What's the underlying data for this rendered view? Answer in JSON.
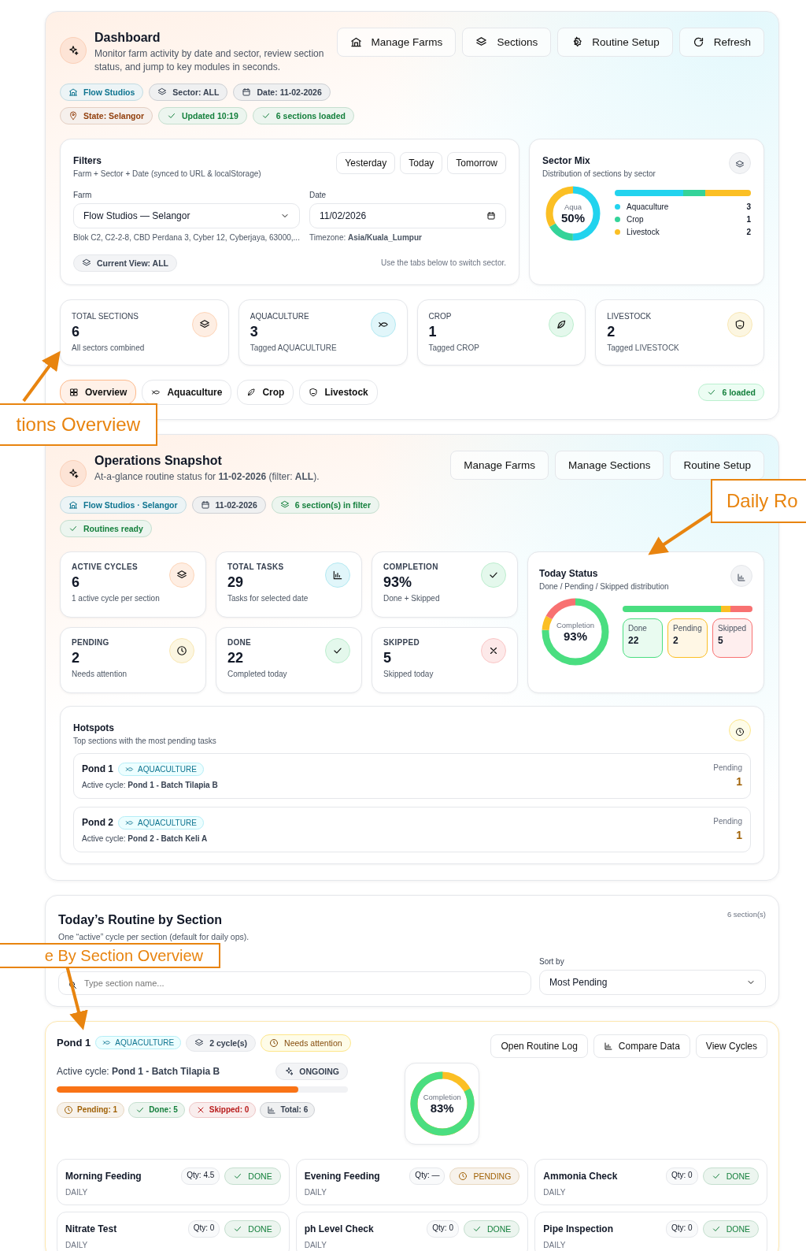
{
  "dashboard": {
    "title": "Dashboard",
    "subtitle": "Monitor farm activity by date and sector, review section status, and jump to key modules in seconds.",
    "actions": [
      {
        "label": "Manage Farms",
        "kind": "farm"
      },
      {
        "label": "Sections",
        "kind": "layers"
      },
      {
        "label": "Routine Setup",
        "kind": "gear"
      },
      {
        "label": "Refresh",
        "kind": "refresh"
      }
    ],
    "chip_rows": [
      [
        {
          "label": "Flow Studios",
          "kind": "farm",
          "color": "#0e7490"
        },
        {
          "label": "Sector: ALL",
          "kind": "layers",
          "color": "#374151"
        },
        {
          "label": "Date: 11-02-2026",
          "kind": "calendar",
          "color": "#374151"
        }
      ],
      [
        {
          "label": "State: Selangor",
          "kind": "pin",
          "color": "#92400e"
        },
        {
          "label": "Updated 10:19",
          "kind": "check",
          "color": "#15803d"
        },
        {
          "label": "6 sections loaded",
          "kind": "check",
          "color": "#15803d"
        }
      ]
    ],
    "filters": {
      "title": "Filters",
      "subtitle": "Farm + Sector + Date (synced to URL & localStorage)",
      "quick": [
        "Yesterday",
        "Today",
        "Tomorrow"
      ],
      "farm_label": "Farm",
      "farm_value": "Flow Studios — Selangor",
      "address": "Blok C2, C2-2-8, CBD Perdana 3, Cyber 12, Cyberjaya, 63000,...",
      "date_label": "Date",
      "date_value": "11/02/2026",
      "timezone": "Timezone: **Asia/Kuala_Lumpur**",
      "current_view": "Current View: ALL",
      "hint": "Use the tabs below to switch sector."
    },
    "sector_mix": {
      "title": "Sector Mix",
      "subtitle": "Distribution of sections by sector",
      "center_label": "Aqua",
      "center_value": "50%",
      "sectors": [
        {
          "name": "Aquaculture",
          "count": "3",
          "color": "#22d3ee"
        },
        {
          "name": "Crop",
          "count": "1",
          "color": "#34d399"
        },
        {
          "name": "Livestock",
          "count": "2",
          "color": "#fbbf24"
        }
      ]
    },
    "stats": [
      {
        "label": "TOTAL SECTIONS",
        "value": "6",
        "note": "All sectors combined",
        "kind": "layers"
      },
      {
        "label": "AQUACULTURE",
        "value": "3",
        "note": "Tagged AQUACULTURE",
        "kind": "fish"
      },
      {
        "label": "CROP",
        "value": "1",
        "note": "Tagged CROP",
        "kind": "leaf"
      },
      {
        "label": "LIVESTOCK",
        "value": "2",
        "note": "Tagged LIVESTOCK",
        "kind": "shield"
      }
    ],
    "tabs": [
      {
        "label": "Overview",
        "kind": "grid",
        "selected": true
      },
      {
        "label": "Aquaculture",
        "kind": "fish",
        "selected": false
      },
      {
        "label": "Crop",
        "kind": "leaf",
        "selected": false
      },
      {
        "label": "Livestock",
        "kind": "shield",
        "selected": false
      }
    ],
    "loaded_badge": "6 loaded"
  },
  "snapshot": {
    "title": "Operations Snapshot",
    "subtitle": "At-a-glance routine status for **11-02-2026** (filter: **ALL**).",
    "actions": [
      "Manage Farms",
      "Manage Sections",
      "Routine Setup"
    ],
    "chip_rows": [
      [
        {
          "label": "**Flow Studios** · Selangor",
          "kind": "farm",
          "color": "#0e7490"
        },
        {
          "label": "11-02-2026",
          "kind": "calendar",
          "color": "#374151"
        },
        {
          "label": "6 section(s) in filter",
          "kind": "layers",
          "color": "#15803d"
        }
      ],
      [
        {
          "label": "Routines ready",
          "kind": "check",
          "color": "#15803d"
        }
      ]
    ],
    "metrics": [
      {
        "label": "ACTIVE CYCLES",
        "value": "6",
        "note": "1 active cycle per section",
        "kind": "layers"
      },
      {
        "label": "TOTAL TASKS",
        "value": "29",
        "note": "Tasks for selected date",
        "kind": "chart"
      },
      {
        "label": "COMPLETION",
        "value": "93%",
        "note": "Done + Skipped",
        "kind": "check"
      },
      {
        "label": "PENDING",
        "value": "2",
        "note": "Needs attention",
        "kind": "clock"
      },
      {
        "label": "DONE",
        "value": "22",
        "note": "Completed today",
        "kind": "check"
      },
      {
        "label": "SKIPPED",
        "value": "5",
        "note": "Skipped today",
        "kind": "x"
      }
    ],
    "today_status": {
      "title": "Today Status",
      "subtitle": "Done / Pending / Skipped distribution",
      "center_label": "Completion",
      "center_value": "93%",
      "parts": [
        {
          "label": "Done",
          "value": "22",
          "color": "#4ade80"
        },
        {
          "label": "Pending",
          "value": "2",
          "color": "#fbbf24"
        },
        {
          "label": "Skipped",
          "value": "5",
          "color": "#f87171"
        }
      ]
    },
    "hotspots": {
      "title": "Hotspots",
      "subtitle": "Top sections with the most pending tasks",
      "items": [
        {
          "name": "Pond 1",
          "tag": "AQUACULTURE",
          "cycle": "Active cycle: **Pond 1 - Batch Tilapia B**",
          "pending_label": "Pending",
          "pending": "1"
        },
        {
          "name": "Pond 2",
          "tag": "AQUACULTURE",
          "cycle": "Active cycle: **Pond 2 - Batch Keli A**",
          "pending_label": "Pending",
          "pending": "1"
        }
      ]
    }
  },
  "routine": {
    "title": "Today’s Routine by Section",
    "subtitle": "One “active” cycle per section (default for daily ops).",
    "count": "6 section(s)",
    "search_placeholder": "Type section name...",
    "sort_label": "Sort by",
    "sort_value": "Most Pending"
  },
  "section_card": {
    "name": "Pond 1",
    "tag": "AQUACULTURE",
    "cycles": "2 cycle(s)",
    "attention": "Needs attention",
    "actions": [
      {
        "label": "Open Routine Log",
        "kind": "plain"
      },
      {
        "label": "Compare Data",
        "kind": "chart"
      },
      {
        "label": "View Cycles",
        "kind": "plain"
      }
    ],
    "cycle": "Active cycle: **Pond 1 - Batch Tilapia B**",
    "status": "ONGOING",
    "progress": {
      "level": 0.83
    },
    "counts": [
      {
        "label": "Pending: **1**",
        "kind": "clock",
        "color": "#a16207"
      },
      {
        "label": "Done: **5**",
        "kind": "check",
        "color": "#15803d"
      },
      {
        "label": "Skipped: **0**",
        "kind": "x",
        "color": "#b91c1c"
      },
      {
        "label": "Total: **6**",
        "kind": "chart",
        "color": "#374151"
      }
    ],
    "completion": {
      "label": "Completion",
      "value": "83%",
      "level": 0.83
    },
    "tasks": [
      {
        "name": "Morning Feeding",
        "qty": "Qty: 4.5",
        "status": "DONE",
        "kind": "done",
        "freq": "DAILY"
      },
      {
        "name": "Evening Feeding",
        "qty": "Qty: —",
        "status": "PENDING",
        "kind": "pending",
        "freq": "DAILY"
      },
      {
        "name": "Ammonia Check",
        "qty": "Qty: 0",
        "status": "DONE",
        "kind": "done",
        "freq": "DAILY"
      },
      {
        "name": "Nitrate Test",
        "qty": "Qty: 0",
        "status": "DONE",
        "kind": "done",
        "freq": "DAILY"
      },
      {
        "name": "ph Level Check",
        "qty": "Qty: 0",
        "status": "DONE",
        "kind": "done",
        "freq": "DAILY"
      },
      {
        "name": "Pipe Inspection",
        "qty": "Qty: 0",
        "status": "DONE",
        "kind": "done",
        "freq": "DAILY"
      }
    ]
  },
  "callouts": [
    "tions Overview",
    "Daily Ro",
    "e By Section Overview"
  ]
}
